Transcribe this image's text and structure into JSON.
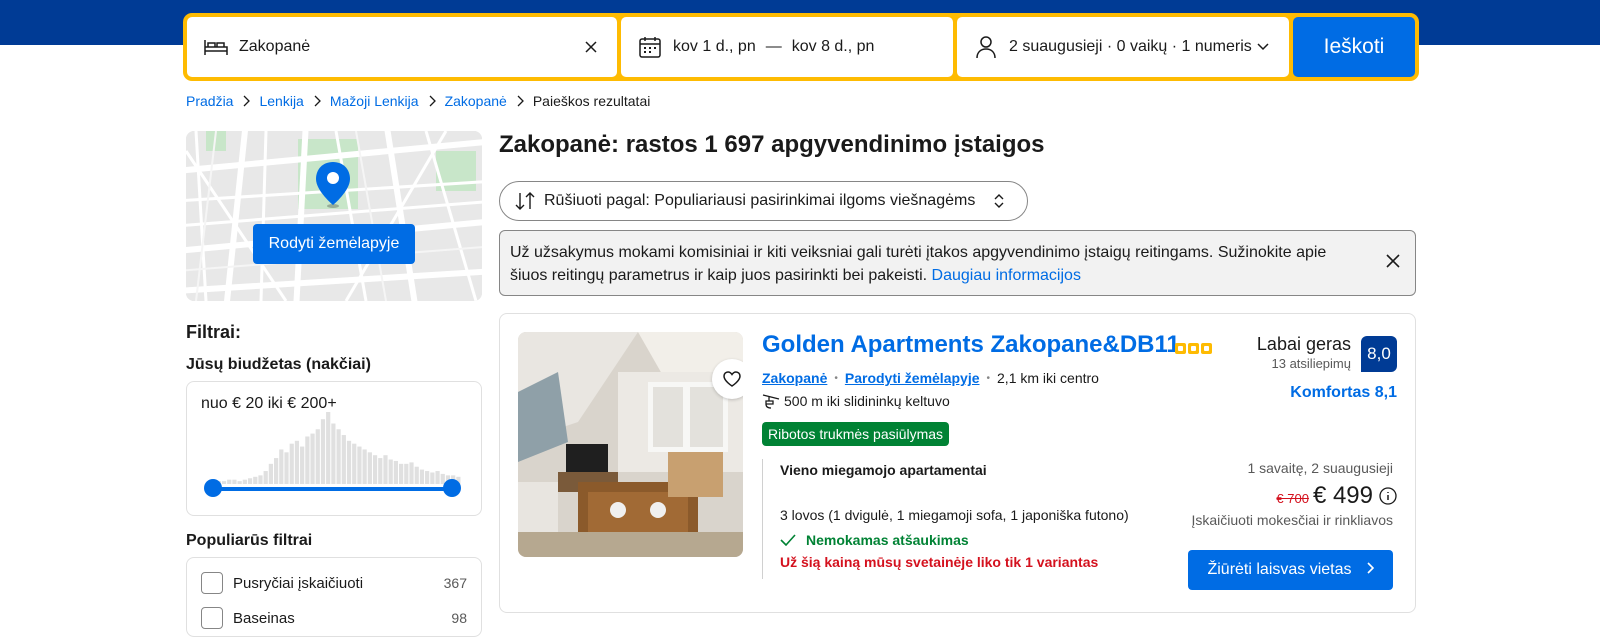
{
  "search": {
    "destination": "Zakopanė",
    "date_from": "kov 1 d., pn",
    "date_sep": "—",
    "date_to": "kov 8 d., pn",
    "guests": "2 suaugusieji · 0 vaikų · 1 numeris",
    "button": "Ieškoti"
  },
  "breadcrumb": [
    "Pradžia",
    "Lenkija",
    "Mažoji Lenkija",
    "Zakopanė",
    "Paieškos rezultatai"
  ],
  "map": {
    "button": "Rodyti žemėlapyje"
  },
  "filters": {
    "title": "Filtrai:",
    "budget_title": "Jūsų biudžetas (nakčiai)",
    "budget_range": "nuo € 20 iki € 200+",
    "histogram": [
      2,
      2,
      2,
      3,
      3,
      2,
      3,
      4,
      5,
      6,
      9,
      14,
      18,
      24,
      22,
      28,
      30,
      26,
      33,
      35,
      38,
      45,
      50,
      42,
      38,
      34,
      30,
      28,
      26,
      24,
      22,
      20,
      18,
      20,
      17,
      16,
      14,
      14,
      15,
      12,
      10,
      9,
      8,
      9,
      7,
      6,
      6,
      5
    ],
    "popular_title": "Populiarūs filtrai",
    "popular": [
      {
        "label": "Pusryčiai įskaičiuoti",
        "count": "367"
      },
      {
        "label": "Baseinas",
        "count": "98"
      }
    ]
  },
  "results": {
    "title": "Zakopanė: rastos 1 697 apgyvendinimo įstaigos",
    "sort": "Rūšiuoti pagal: Populiariausi pasirinkimai ilgoms viešnagėms",
    "notice": "Už užsakymus mokami komisiniai ir kiti veiksniai gali turėti įtakos apgyvendinimo įstaigų reitingams. Sužinokite apie šiuos reitingų parametrus ir kaip juos pasirinkti bei pakeisti.",
    "notice_link": "Daugiau informacijos"
  },
  "card": {
    "name": "Golden Apartments Zakopane&DB11",
    "city": "Zakopanė",
    "map_link": "Parodyti žemėlapyje",
    "distance": "2,1 km iki centro",
    "ski": "500 m iki slidininkų keltuvo",
    "deal": "Ribotos trukmės pasiūlymas",
    "rating_word": "Labai geras",
    "reviews": "13 atsiliepimų",
    "score": "8,0",
    "comfort": "Komfortas 8,1",
    "room": "Vieno miegamojo apartamentai",
    "beds": "3 lovos (1 dvigulė, 1 miegamoji sofa, 1 japoniška futono)",
    "free_cancel": "Nemokamas atšaukimas",
    "scarcity": "Už šią kainą mūsų svetainėje liko tik 1 variantas",
    "stay": "1 savaitę, 2 suaugusieji",
    "old_price": "€ 700",
    "price": "€ 499",
    "taxes": "Įskaičiuoti mokesčiai ir rinkliavos",
    "button": "Žiūrėti laisvas vietas"
  },
  "colors": {
    "brand": "#003b95",
    "accent": "#006ce4",
    "yellow": "#febb02",
    "green": "#008234",
    "red": "#d4111e"
  }
}
